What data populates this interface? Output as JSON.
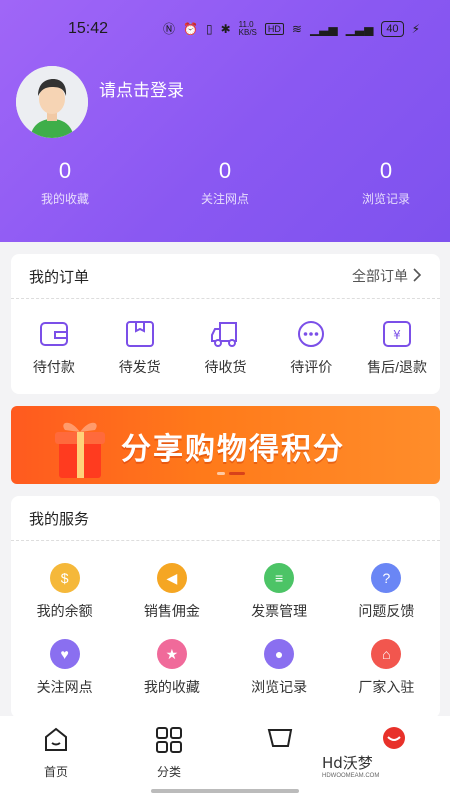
{
  "status_bar": {
    "time": "15:42",
    "net_speed": "11.0\nKB/S",
    "battery": "40"
  },
  "profile": {
    "login_prompt": "请点击登录"
  },
  "stats": [
    {
      "value": "0",
      "label": "我的收藏"
    },
    {
      "value": "0",
      "label": "关注网点"
    },
    {
      "value": "0",
      "label": "浏览记录"
    }
  ],
  "orders": {
    "title": "我的订单",
    "all_link": "全部订单",
    "items": [
      {
        "label": "待付款",
        "icon": "wallet-icon"
      },
      {
        "label": "待发货",
        "icon": "box-icon"
      },
      {
        "label": "待收货",
        "icon": "truck-icon"
      },
      {
        "label": "待评价",
        "icon": "comment-icon"
      },
      {
        "label": "售后/退款",
        "icon": "refund-icon"
      }
    ]
  },
  "banner": {
    "text": "分享购物得积分"
  },
  "services": {
    "title": "我的服务",
    "items": [
      {
        "label": "我的余额",
        "icon": "moneybag-icon",
        "color": "#f5b83a"
      },
      {
        "label": "销售佣金",
        "icon": "megaphone-icon",
        "color": "#f5a623"
      },
      {
        "label": "发票管理",
        "icon": "invoice-icon",
        "color": "#4cc466"
      },
      {
        "label": "问题反馈",
        "icon": "question-icon",
        "color": "#6a86f5"
      },
      {
        "label": "关注网点",
        "icon": "heart-icon",
        "color": "#8a6ff0"
      },
      {
        "label": "我的收藏",
        "icon": "star-icon",
        "color": "#f06a9a"
      },
      {
        "label": "浏览记录",
        "icon": "footprint-icon",
        "color": "#8a6ff0"
      },
      {
        "label": "厂家入驻",
        "icon": "shop-icon",
        "color": "#f2564e"
      }
    ]
  },
  "tabbar": [
    {
      "label": "首页",
      "icon": "home-icon"
    },
    {
      "label": "分类",
      "icon": "grid-icon"
    },
    {
      "label": "",
      "icon": "cart-icon"
    },
    {
      "label": "",
      "icon": "profile-icon"
    }
  ],
  "watermark": {
    "text": "Hd沃梦",
    "sub": "HDWOOMEAM.COM"
  },
  "colors": {
    "brand": "#8a58f2",
    "accent": "#7b4fe8",
    "banner": "#ff6a1f"
  }
}
